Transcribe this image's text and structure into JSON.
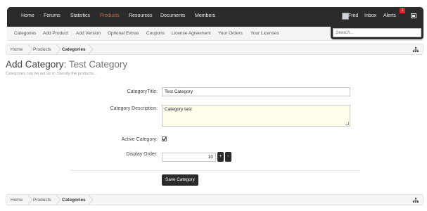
{
  "topnav": {
    "items": [
      "Home",
      "Forums",
      "Statistics",
      "Products",
      "Resources",
      "Documents",
      "Members"
    ],
    "active": "Products",
    "user": "Fred",
    "inbox": "Inbox",
    "alerts": "Alerts",
    "alerts_count": "1"
  },
  "subnav": {
    "items": [
      "Categories",
      "Add Product",
      "Add Version",
      "Optional Extras",
      "Coupons",
      "License Agreement",
      "Your Orders",
      "Your Licenses"
    ],
    "search_placeholder": "Search..."
  },
  "breadcrumb": {
    "items": [
      "Home",
      "Products",
      "Categories"
    ]
  },
  "page": {
    "title": "Add Category:",
    "title_value": "Test Category",
    "description": "Categories can be set up to classify the products..."
  },
  "form": {
    "title_label": "CategoryTitle:",
    "title_value": "Test Category",
    "description_label": "Category Description:",
    "description_value": "Category test",
    "active_label": "Active Category:",
    "active_checked": true,
    "order_label": "Display Order:",
    "order_value": "10",
    "plus_label": "+",
    "minus_label": "-",
    "save_label": "Save Category"
  },
  "icons": {
    "sitemap": "sitemap-icon",
    "messages": "message-icon",
    "avatar": "avatar-icon"
  },
  "colors": {
    "nav_bg": "#2b2b2b",
    "active": "#e0632a",
    "badge": "#d42a2a"
  }
}
